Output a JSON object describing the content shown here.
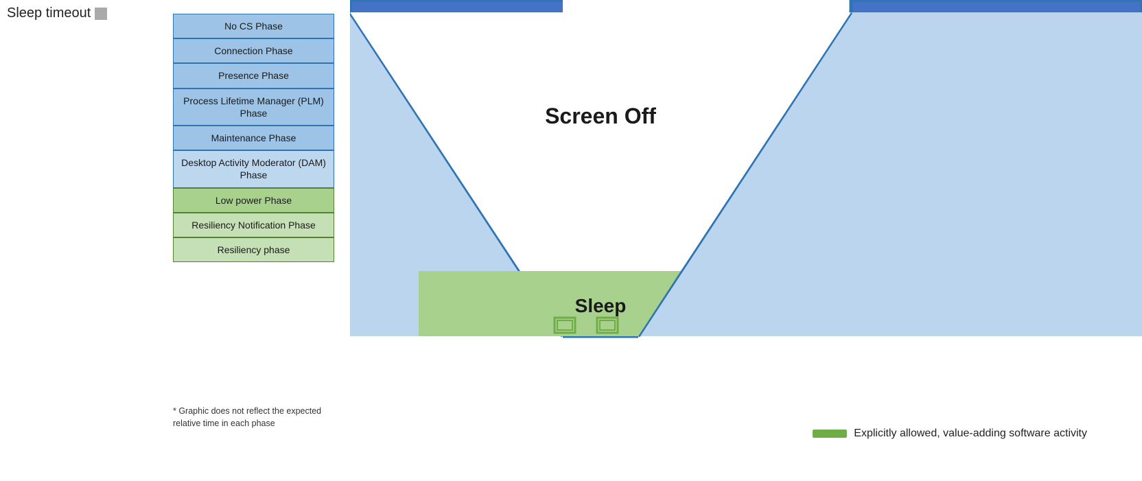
{
  "header": {
    "sleep_timeout_label": "Sleep timeout"
  },
  "phases": [
    {
      "id": "no-cs",
      "label": "No CS Phase",
      "color": "blue"
    },
    {
      "id": "connection",
      "label": "Connection Phase",
      "color": "blue"
    },
    {
      "id": "presence",
      "label": "Presence Phase",
      "color": "blue"
    },
    {
      "id": "plm",
      "label": "Process Lifetime Manager (PLM) Phase",
      "color": "blue"
    },
    {
      "id": "maintenance",
      "label": "Maintenance Phase",
      "color": "blue"
    },
    {
      "id": "dam",
      "label": "Desktop Activity Moderator (DAM) Phase",
      "color": "blue-mid"
    },
    {
      "id": "low-power",
      "label": "Low power Phase",
      "color": "green"
    },
    {
      "id": "resiliency-notification",
      "label": "Resiliency Notification Phase",
      "color": "green-light"
    },
    {
      "id": "resiliency",
      "label": "Resiliency phase",
      "color": "green-light"
    }
  ],
  "footnote": "* Graphic does not reflect the expected relative time in each phase",
  "diagram": {
    "screen_off_label": "Screen Off",
    "sleep_label": "Sleep"
  },
  "legend": {
    "label": "Explicitly allowed, value-adding software activity"
  }
}
